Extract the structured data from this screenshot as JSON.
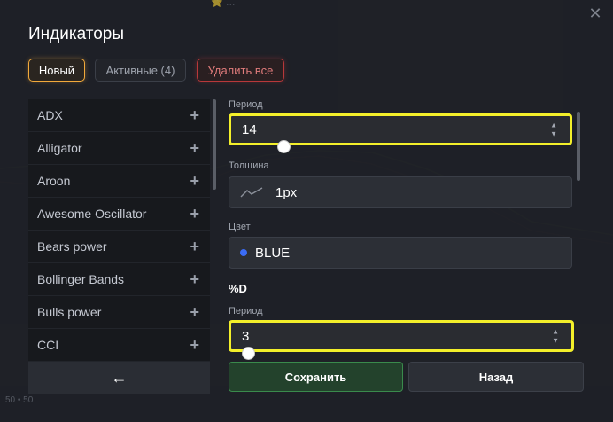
{
  "background": {
    "top_text": "⭐ …",
    "bottom_text": "50 • 50"
  },
  "modal": {
    "title": "Индикаторы",
    "close_icon": "close-icon"
  },
  "tabs": {
    "new_label": "Новый",
    "active_label": "Активные (4)",
    "delete_label": "Удалить все"
  },
  "indicator_list": {
    "items": [
      {
        "label": "ADX"
      },
      {
        "label": "Alligator"
      },
      {
        "label": "Aroon"
      },
      {
        "label": "Awesome Oscillator"
      },
      {
        "label": "Bears power"
      },
      {
        "label": "Bollinger Bands"
      },
      {
        "label": "Bulls power"
      },
      {
        "label": "CCI"
      }
    ],
    "add_icon": "plus-icon",
    "back_icon": "arrow-left-icon",
    "back_glyph": "←"
  },
  "form": {
    "period_label": "Период",
    "period_value": "14",
    "thickness_label": "Толщина",
    "thickness_value": "1px",
    "color_label": "Цвет",
    "color_value": "BLUE",
    "color_hex": "#3b6cf6",
    "section_d": "%D",
    "period_d_label": "Период",
    "period_d_value": "3",
    "highlight_color": "#f3ef2a"
  },
  "actions": {
    "save_label": "Сохранить",
    "back_label": "Назад"
  },
  "colors": {
    "accent_orange": "#f2a93b",
    "danger_red": "#b8383a",
    "success_green": "#3a8a4c"
  }
}
